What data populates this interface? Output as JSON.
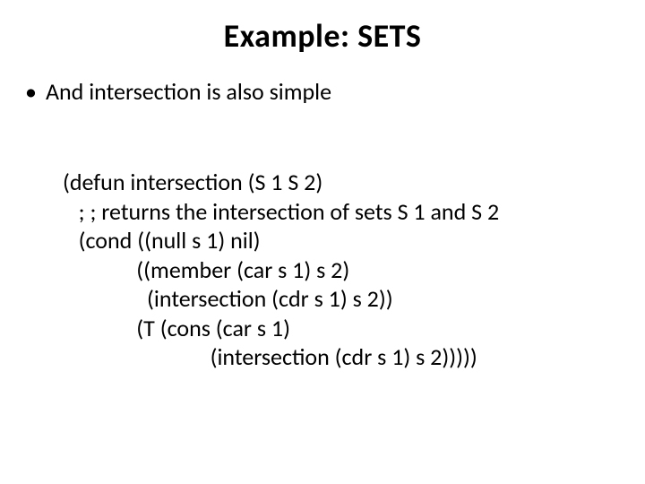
{
  "title": "Example: SETS",
  "bullet": {
    "dot": "•",
    "text": "And intersection is also simple"
  },
  "code": {
    "l1": "(defun intersection (S 1 S 2)",
    "l2": "   ; ; returns the intersection of sets S 1 and S 2",
    "l3": "   (cond ((null s 1) nil)",
    "l4": "              ((member (car s 1) s 2)",
    "l5": "                (intersection (cdr s 1) s 2))",
    "l6": "              (T (cons (car s 1)",
    "l7": "                            (intersection (cdr s 1) s 2)))))"
  }
}
